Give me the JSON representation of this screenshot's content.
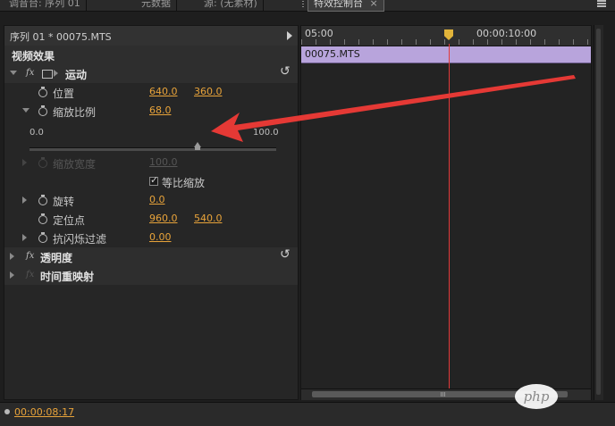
{
  "tabs": [
    {
      "label": "调音台: 序列 01"
    },
    {
      "label": "元数据"
    },
    {
      "label": "源: (无素材)"
    },
    {
      "label": "特效控制台",
      "close": "×"
    }
  ],
  "effect_controls": {
    "clip_title": "序列 01 * 00075.MTS",
    "section_title": "视频效果",
    "motion": {
      "name": "运动",
      "position": {
        "label": "位置",
        "x": "640.0",
        "y": "360.0"
      },
      "scale": {
        "label": "缩放比例",
        "value": "68.0",
        "min": "0.0",
        "max": "100.0"
      },
      "scale_width": {
        "label": "缩放宽度",
        "value": "100.0"
      },
      "uniform_scale": {
        "label": "等比缩放",
        "checked": true
      },
      "rotation": {
        "label": "旋转",
        "value": "0.0"
      },
      "anchor_point": {
        "label": "定位点",
        "x": "960.0",
        "y": "540.0"
      },
      "anti_flicker": {
        "label": "抗闪烁过滤",
        "value": "0.00"
      }
    },
    "opacity": {
      "name": "透明度"
    },
    "time_remap": {
      "name": "时间重映射"
    }
  },
  "timeline": {
    "ruler_start": "05:00",
    "ruler_mark": "00:00:10:00",
    "clip_name": "00075.MTS"
  },
  "footer": {
    "timecode": "00:00:08:17"
  },
  "watermark": "php",
  "colors": {
    "value": "#e8a33a",
    "clip": "#b8a4dc",
    "playhead": "#e23a3a",
    "annotation_arrow": "#e53935"
  },
  "icons": [
    "stopwatch-icon",
    "reset-icon",
    "fx-icon",
    "motion-icon",
    "disclosure-triangle-icon",
    "play-icon",
    "menu-icon"
  ]
}
